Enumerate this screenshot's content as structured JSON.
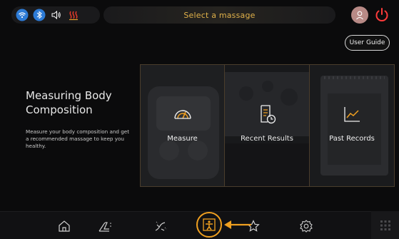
{
  "topbar": {
    "status_icons": [
      "wifi-icon",
      "bluetooth-icon",
      "volume-icon",
      "heat-icon"
    ],
    "title": "Select a massage",
    "user_guide_label": "User Guide"
  },
  "intro": {
    "heading": "Measuring Body Composition",
    "description": "Measure your body composition and get a recommended massage to keep you healthy."
  },
  "cards": [
    {
      "label": "Measure",
      "icon": "gauge-icon"
    },
    {
      "label": "Recent Results",
      "icon": "document-clock-icon"
    },
    {
      "label": "Past Records",
      "icon": "chart-line-icon"
    }
  ],
  "bottom_nav": {
    "items": [
      "home-icon",
      "recline-icon",
      "stretch-icon",
      "body-composition-icon",
      "favorites-icon",
      "settings-icon",
      "apps-grid-icon"
    ],
    "active": "body-composition-icon"
  },
  "colors": {
    "accent": "#f0a020",
    "title_text": "#e0b14a",
    "card_border": "#4a3d2c",
    "power": "#ff3b3b"
  }
}
